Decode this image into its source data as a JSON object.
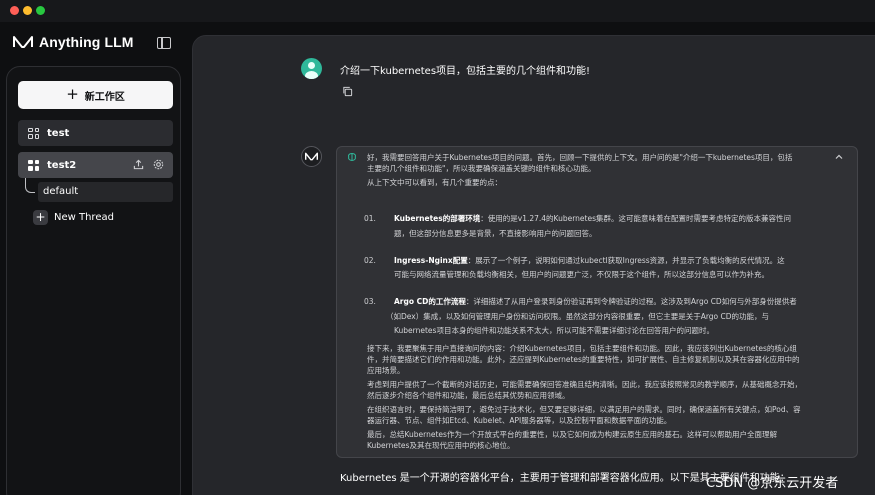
{
  "window": {
    "traffic_lights": [
      "#fe5f57",
      "#febc2e",
      "#28c840"
    ]
  },
  "sidebar": {
    "brand": "Anything LLM",
    "new_workspace": "新工作区",
    "workspaces": [
      {
        "name": "test"
      },
      {
        "name": "test2"
      }
    ],
    "threads": [
      {
        "name": "default"
      }
    ],
    "new_thread": "New Thread"
  },
  "chat": {
    "user_message": "介绍一下kubernetes项目，包括主要的几个组件和功能!",
    "thinking": {
      "intro_1": "好，我需要回答用户关于Kubernetes项目的问题。首先，回顾一下提供的上下文。用户问的是\"介绍一下kubernetes项目，包括",
      "intro_2": "主要的几个组件和功能\"，所以我要确保涵盖关键的组件和核心功能。",
      "intro_3": "从上下文中可以看到，有几个重要的点：",
      "items": [
        {
          "num": "01.",
          "title": "Kubernetes的部署环境",
          "line1": "：使用的是v1.27.4的Kubernetes集群。这可能意味着在配置时需要考虑特定的版本兼容性问",
          "line2": "题，但这部分信息更多是背景，不直接影响用户的问题回答。"
        },
        {
          "num": "02.",
          "title": "Ingress-Nginx配置",
          "line1": "：展示了一个例子，说明如何通过kubectl获取Ingress资源，并显示了负载均衡的反代情况。这",
          "line2": "可能与网络流量管理和负载均衡相关，但用户的问题更广泛，不仅限于这个组件，所以这部分信息可以作为补充。"
        },
        {
          "num": "03.",
          "title": "Argo CD的工作流程",
          "line1": "：详细描述了从用户登录到身份验证再到令牌验证的过程。这涉及到Argo CD如何与外部身份提供者",
          "line2": "（如Dex）集成，以及如何管理用户身份和访问权限。虽然这部分内容很重要，但它主要是关于Argo CD的功能，与",
          "line3": "Kubernetes项目本身的组件和功能关系不太大，所以可能不需要详细讨论在回答用户的问题时。"
        }
      ],
      "para1_1": "接下来，我要聚焦于用户直接询问的内容：介绍Kubernetes项目，包括主要组件和功能。因此，我应该列出Kubernetes的核心组",
      "para1_2": "件，并简要描述它们的作用和功能。此外，还应提到Kubernetes的重要特性，如可扩展性、自主修复机制以及其在容器化应用中的",
      "para1_3": "应用场景。",
      "para2_1": "考虑到用户提供了一个截断的对话历史，可能需要确保回答准确且结构清晰。因此，我应该按照常见的教学顺序，从基础概念开始，",
      "para2_2": "然后逐步介绍各个组件和功能，最后总结其优势和应用领域。",
      "para3_1": "在组织语言时，要保持简洁明了，避免过于技术化，但又要足够详细，以满足用户的需求。同时，确保涵盖所有关键点，如Pod、容",
      "para3_2": "器运行器、节点、组件如Etcd、Kubelet、API服务器等，以及控制平面和数据平面的功能。",
      "para4_1": "最后，总结Kubernetes作为一个开放式平台的重要性，以及它如何成为构建云原生应用的基石。这样可以帮助用户全面理解",
      "para4_2": "Kubernetes及其在现代应用中的核心地位。"
    },
    "answer_preview": "Kubernetes 是一个开源的容器化平台，主要用于管理和部署容器化应用。以下是其主要组件和功能："
  },
  "watermark": "CSDN @京东云开发者",
  "icons": {
    "brand": "anything-llm-logo-icon",
    "sidebar_toggle": "sidebar-toggle-icon",
    "workspace": "grid-icon",
    "upload": "upload-icon",
    "settings": "gear-icon",
    "copy": "copy-icon",
    "thinking": "brain-icon",
    "collapse": "chevron-up-icon"
  }
}
